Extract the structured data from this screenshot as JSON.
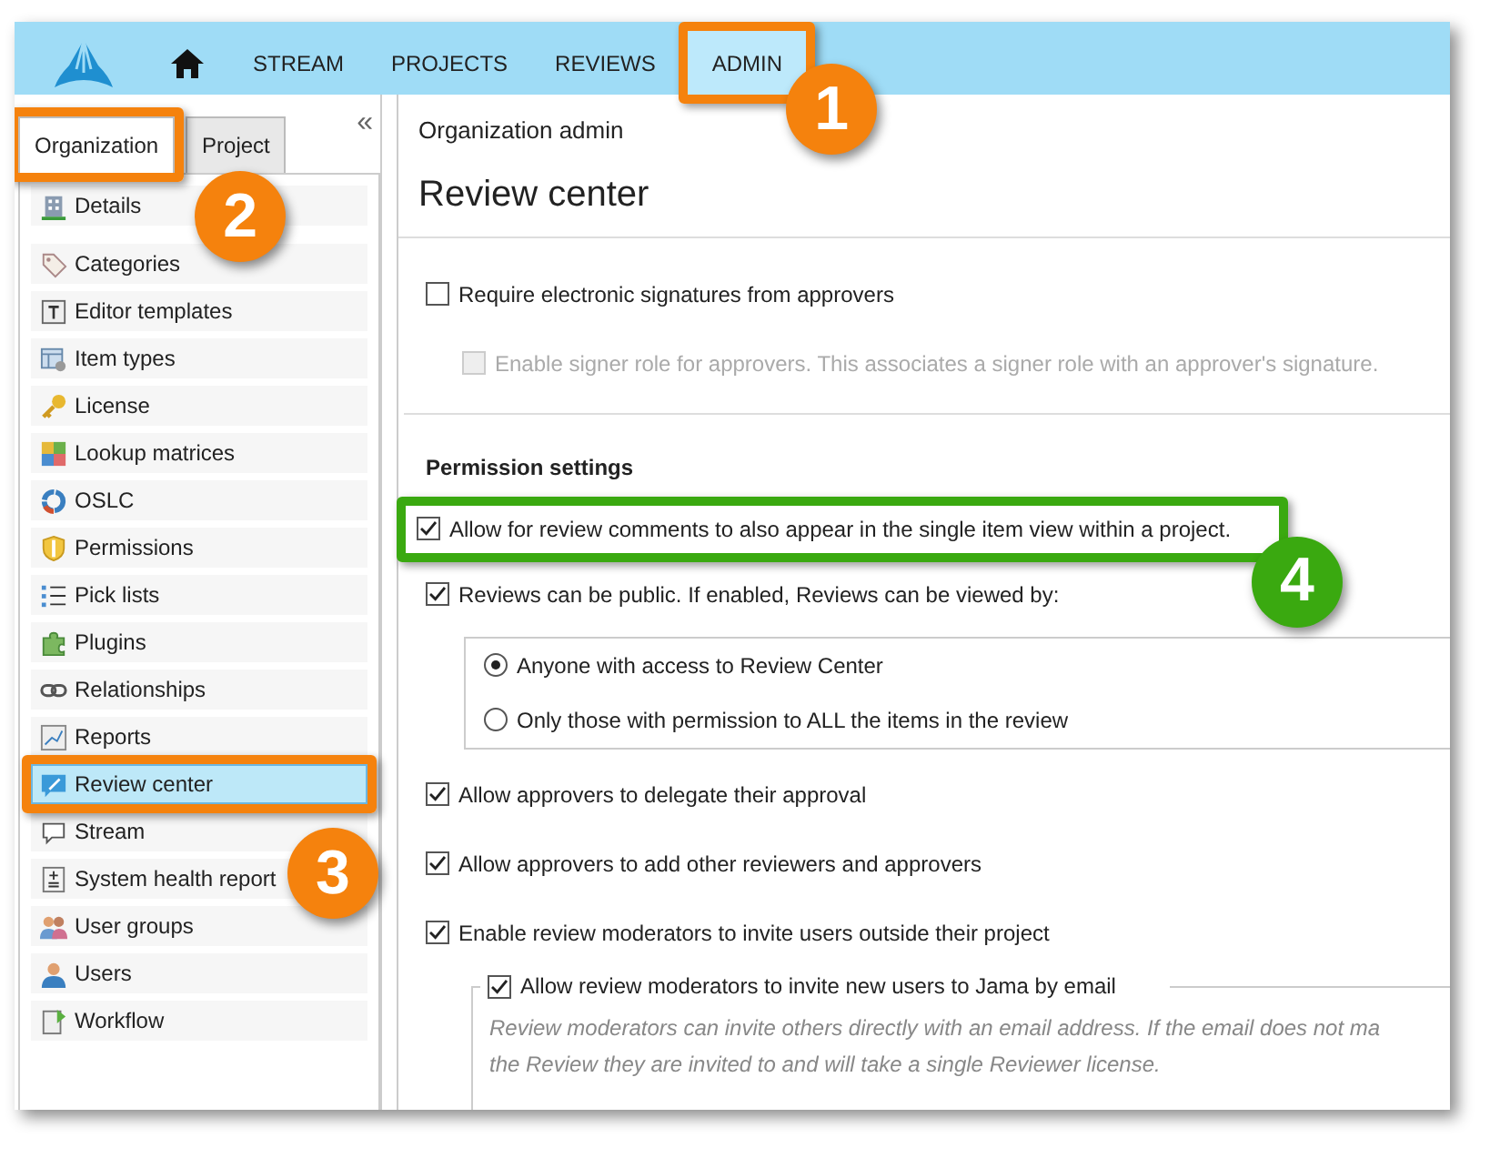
{
  "navbar": {
    "items": [
      {
        "kind": "home",
        "selected": false
      },
      {
        "kind": "text",
        "label": "STREAM",
        "selected": false
      },
      {
        "kind": "text",
        "label": "PROJECTS",
        "selected": false
      },
      {
        "kind": "text",
        "label": "REVIEWS",
        "selected": false
      },
      {
        "kind": "text",
        "label": "ADMIN",
        "selected": true
      }
    ]
  },
  "sidebar": {
    "tabs": [
      {
        "label": "Organization",
        "selected": true
      },
      {
        "label": "Project",
        "selected": false
      }
    ],
    "collapse": "«",
    "items": [
      {
        "label": "Details",
        "selected": false
      },
      {
        "label": "Categories",
        "selected": false
      },
      {
        "label": "Editor templates",
        "selected": false
      },
      {
        "label": "Item types",
        "selected": false
      },
      {
        "label": "License",
        "selected": false
      },
      {
        "label": "Lookup matrices",
        "selected": false
      },
      {
        "label": "OSLC",
        "selected": false
      },
      {
        "label": "Permissions",
        "selected": false
      },
      {
        "label": "Pick lists",
        "selected": false
      },
      {
        "label": "Plugins",
        "selected": false
      },
      {
        "label": "Relationships",
        "selected": false
      },
      {
        "label": "Reports",
        "selected": false
      },
      {
        "label": "Review center",
        "selected": true
      },
      {
        "label": "Stream",
        "selected": false
      },
      {
        "label": "System health report",
        "selected": false
      },
      {
        "label": "User groups",
        "selected": false
      },
      {
        "label": "Users",
        "selected": false
      },
      {
        "label": "Workflow",
        "selected": false
      }
    ]
  },
  "main": {
    "breadcrumb": "Organization admin",
    "title": "Review center",
    "signature_options": [
      {
        "kind": "checkbox",
        "label": "Require electronic signatures from approvers",
        "checked": false,
        "disabled": false,
        "nested": false
      },
      {
        "kind": "checkbox",
        "label": "Enable signer role for approvers. This associates a signer role with an approver's signature.",
        "checked": false,
        "disabled": true,
        "nested": true
      }
    ],
    "permission_heading": "Permission settings",
    "permission_options": [
      {
        "kind": "checkbox",
        "label": "Allow for review comments to also appear in the single item view within a project.",
        "checked": true
      },
      {
        "kind": "checkbox",
        "label": "Reviews can be public. If enabled, Reviews can be viewed by:",
        "checked": true
      },
      {
        "kind": "radios",
        "options": [
          {
            "label": "Anyone with access to Review Center",
            "selected": true
          },
          {
            "label": "Only those with permission to ALL the items in the review",
            "selected": false
          }
        ]
      },
      {
        "kind": "checkbox",
        "label": "Allow approvers to delegate their approval",
        "checked": true
      },
      {
        "kind": "checkbox",
        "label": "Allow approvers to add other reviewers and approvers",
        "checked": true
      },
      {
        "kind": "checkbox",
        "label": "Enable review moderators to invite users outside their project",
        "checked": true
      },
      {
        "kind": "group",
        "label": "Allow review moderators to invite new users to Jama by email",
        "checked": true,
        "description_lines": [
          "Review moderators can invite others directly with an email address. If the email does not ma",
          "the Review they are invited to and will take a single Reviewer license."
        ]
      }
    ]
  },
  "callouts": [
    {
      "number": "1",
      "color": "#f5820d"
    },
    {
      "number": "2",
      "color": "#f5820d"
    },
    {
      "number": "3",
      "color": "#f5820d"
    },
    {
      "number": "4",
      "color": "#3aa910"
    }
  ]
}
